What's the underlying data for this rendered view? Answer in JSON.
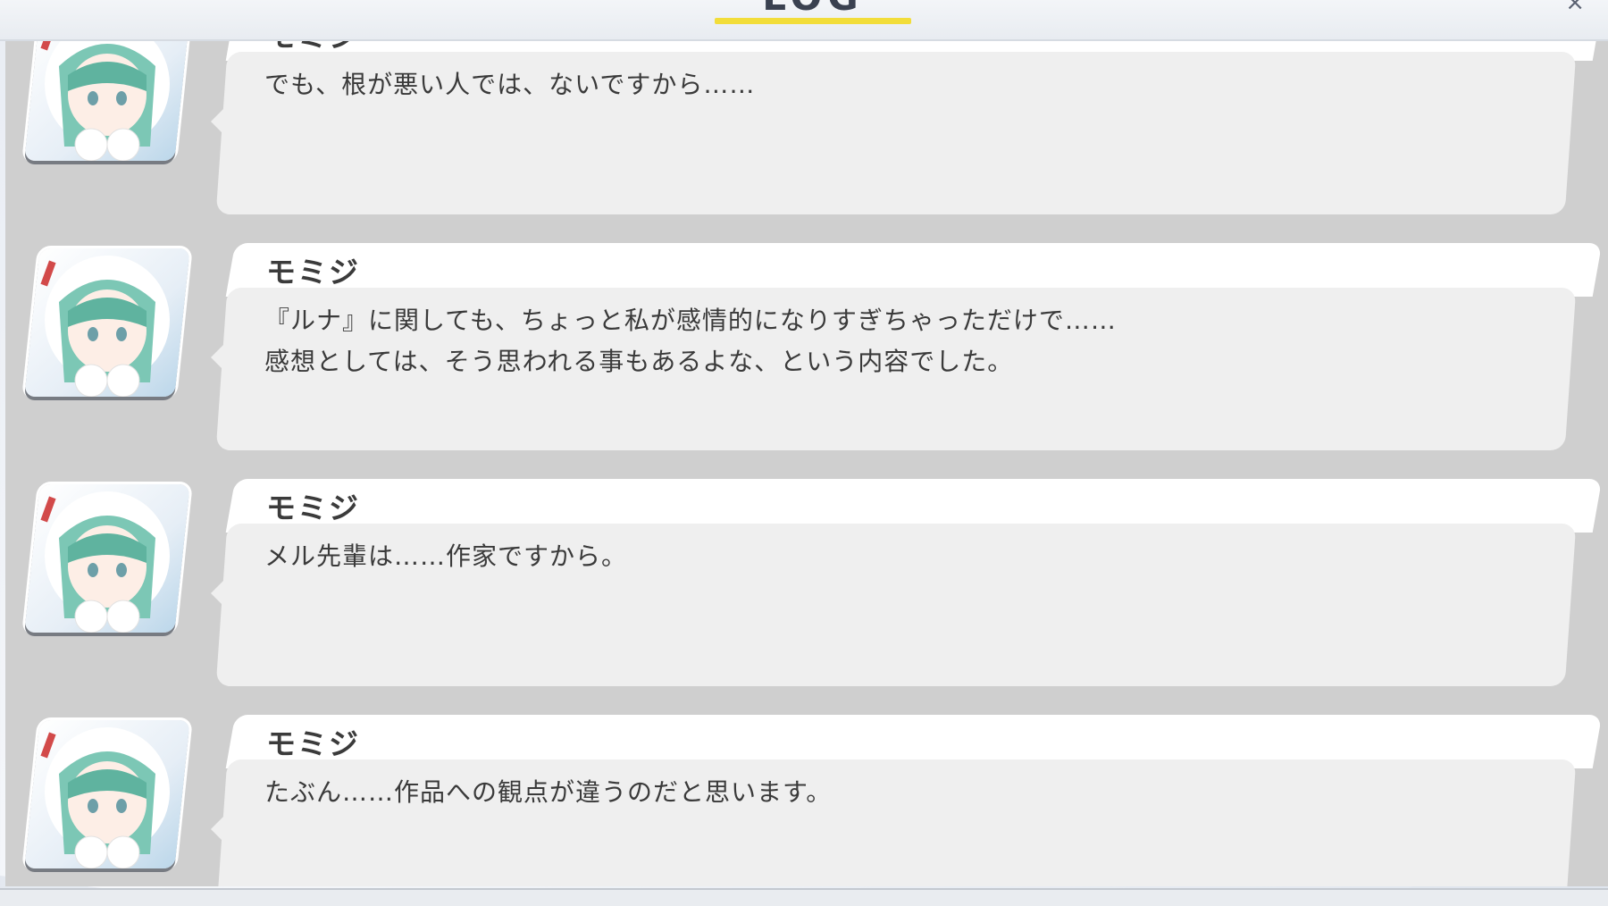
{
  "header": {
    "title": "LOG",
    "close_glyph": "×",
    "accent_color": "#f2dd3a"
  },
  "log": {
    "entries": [
      {
        "speaker": "モミジ",
        "text": "でも、根が悪い人では、ないですから……"
      },
      {
        "speaker": "モミジ",
        "text": "『ルナ』に関しても、ちょっと私が感情的になりすぎちゃっただけで……\n感想としては、そう思われる事もあるよな、という内容でした。"
      },
      {
        "speaker": "モミジ",
        "text": "メル先輩は……作家ですから。"
      },
      {
        "speaker": "モミジ",
        "text": "たぶん……作品への観点が違うのだと思います。"
      }
    ]
  },
  "colors": {
    "panel_bg": "#cfcfcf",
    "bubble_bg": "#efefef",
    "name_plate_bg": "#ffffff",
    "text": "#3a3a3a"
  }
}
